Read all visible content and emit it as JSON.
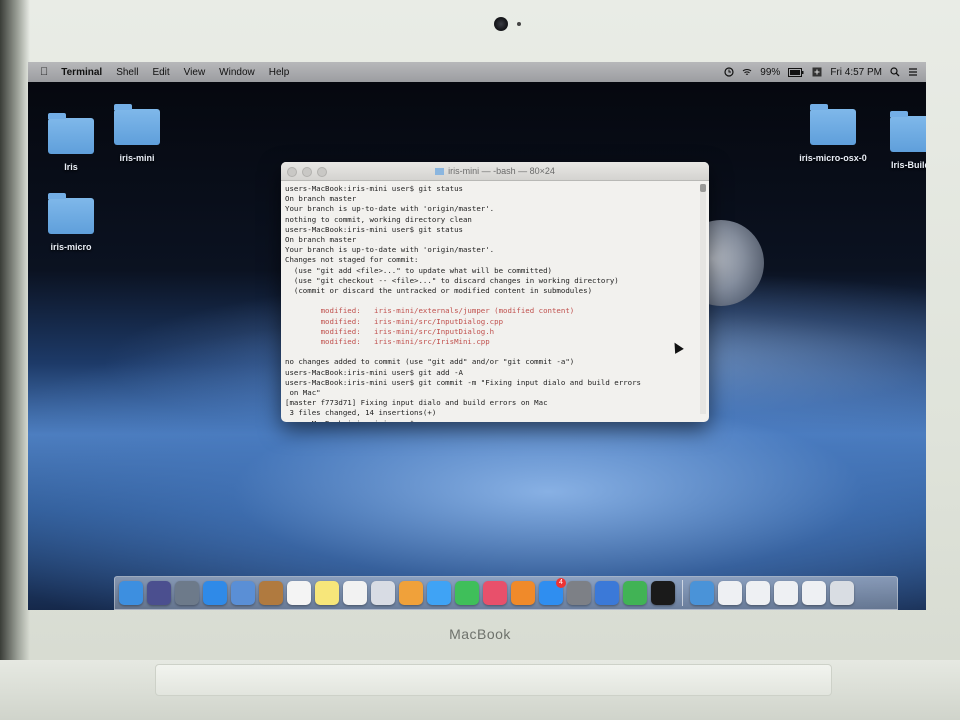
{
  "menubar": {
    "apple_icon": "apple-icon",
    "app_name": "Terminal",
    "items": [
      "Shell",
      "Edit",
      "View",
      "Window",
      "Help"
    ],
    "battery": "99%",
    "clock": "Fri 4:57 PM"
  },
  "desktop": {
    "left_icons": [
      {
        "label": "Iris"
      },
      {
        "label": "iris-mini"
      },
      {
        "label": "iris-micro"
      }
    ],
    "right_icons": [
      {
        "label": "iris-micro-osx-0"
      },
      {
        "label": "Iris-Builds"
      }
    ]
  },
  "terminal": {
    "title": "iris-mini — -bash — 80×24",
    "lines": [
      {
        "text": "users-MacBook:iris-mini user$ git status",
        "style": "normal"
      },
      {
        "text": "On branch master",
        "style": "normal"
      },
      {
        "text": "Your branch is up-to-date with 'origin/master'.",
        "style": "normal"
      },
      {
        "text": "nothing to commit, working directory clean",
        "style": "normal"
      },
      {
        "text": "users-MacBook:iris-mini user$ git status",
        "style": "normal"
      },
      {
        "text": "On branch master",
        "style": "normal"
      },
      {
        "text": "Your branch is up-to-date with 'origin/master'.",
        "style": "normal"
      },
      {
        "text": "Changes not staged for commit:",
        "style": "normal"
      },
      {
        "text": "  (use \"git add <file>...\" to update what will be committed)",
        "style": "normal"
      },
      {
        "text": "  (use \"git checkout -- <file>...\" to discard changes in working directory)",
        "style": "normal"
      },
      {
        "text": "  (commit or discard the untracked or modified content in submodules)",
        "style": "normal"
      },
      {
        "text": "",
        "style": "normal"
      },
      {
        "text": "        modified:   iris-mini/externals/jumper (modified content)",
        "style": "mod"
      },
      {
        "text": "        modified:   iris-mini/src/InputDialog.cpp",
        "style": "mod"
      },
      {
        "text": "        modified:   iris-mini/src/InputDialog.h",
        "style": "mod"
      },
      {
        "text": "        modified:   iris-mini/src/IrisMini.cpp",
        "style": "mod"
      },
      {
        "text": "",
        "style": "normal"
      },
      {
        "text": "no changes added to commit (use \"git add\" and/or \"git commit -a\")",
        "style": "normal"
      },
      {
        "text": "users-MacBook:iris-mini user$ git add -A",
        "style": "normal"
      },
      {
        "text": "users-MacBook:iris-mini user$ git commit -m \"Fixing input dialo and build errors",
        "style": "normal"
      },
      {
        "text": " on Mac\"",
        "style": "normal"
      },
      {
        "text": "[master f773d71] Fixing input dialo and build errors on Mac",
        "style": "normal"
      },
      {
        "text": " 3 files changed, 14 insertions(+)",
        "style": "normal"
      },
      {
        "text": "users-MacBook:iris-mini user$ ▯",
        "style": "normal"
      }
    ]
  },
  "dock": {
    "apps": [
      {
        "name": "finder-icon",
        "color": "#3d8fe0"
      },
      {
        "name": "siri-icon",
        "color": "#4b4f8f"
      },
      {
        "name": "launchpad-icon",
        "color": "#6d7a8a"
      },
      {
        "name": "safari-icon",
        "color": "#2f8ae8"
      },
      {
        "name": "photos-folder-icon",
        "color": "#5a8fd6"
      },
      {
        "name": "contacts-icon",
        "color": "#b07a3f"
      },
      {
        "name": "calendar-icon",
        "color": "#f4f4f4"
      },
      {
        "name": "notes-icon",
        "color": "#f7e67a"
      },
      {
        "name": "reminders-icon",
        "color": "#f2f2f2"
      },
      {
        "name": "preview-icon",
        "color": "#d8dce4"
      },
      {
        "name": "photos-icon",
        "color": "#f0a13a"
      },
      {
        "name": "messages-icon",
        "color": "#3fa3f5"
      },
      {
        "name": "facetime-icon",
        "color": "#3fbf5a"
      },
      {
        "name": "itunes-icon",
        "color": "#e8506b"
      },
      {
        "name": "ibooks-icon",
        "color": "#f08a2a"
      },
      {
        "name": "app-store-icon",
        "color": "#2f8ef0"
      },
      {
        "name": "system-preferences-icon",
        "color": "#7d8086"
      },
      {
        "name": "xcode-icon",
        "color": "#3b79d8"
      },
      {
        "name": "qt-creator-icon",
        "color": "#41b355"
      },
      {
        "name": "terminal-icon",
        "color": "#1a1a1a"
      }
    ],
    "stacks": [
      {
        "name": "downloads-folder-icon",
        "color": "#4a93d8"
      },
      {
        "name": "document-stack-icon",
        "color": "#eef0f3"
      },
      {
        "name": "document-stack-icon",
        "color": "#eef0f3"
      },
      {
        "name": "document-stack-icon",
        "color": "#eef0f3"
      },
      {
        "name": "document-stack-icon",
        "color": "#eef0f3"
      },
      {
        "name": "trash-icon",
        "color": "#d9dde3"
      }
    ],
    "badge_app_store": "4"
  },
  "hardware": {
    "brand": "MacBook"
  }
}
